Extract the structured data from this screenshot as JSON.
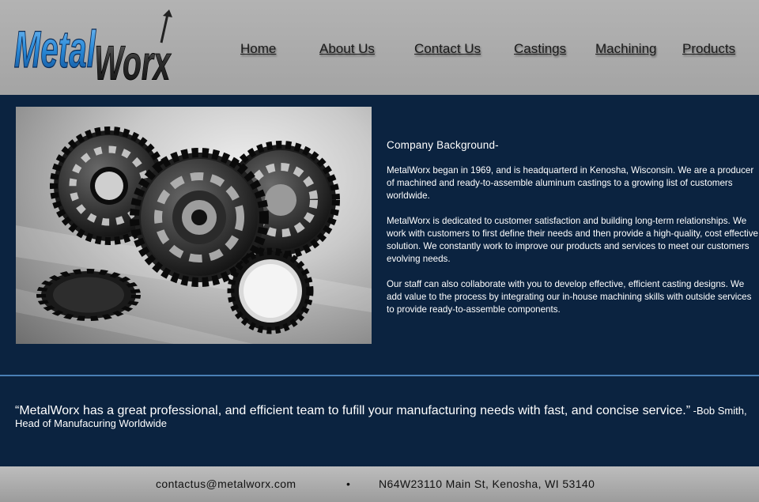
{
  "brand": {
    "logo_text_metal": "Metal",
    "logo_text_worx": "Worx"
  },
  "nav": {
    "items": [
      {
        "label": "Home"
      },
      {
        "label": "About Us"
      },
      {
        "label": "Contact Us"
      },
      {
        "label": "Castings"
      },
      {
        "label": "Machining"
      },
      {
        "label": "Products"
      }
    ]
  },
  "hero_image": {
    "icon": "gears-photo"
  },
  "about": {
    "heading": "Company Background-",
    "paragraphs": [
      "MetalWorx began in 1969, and is headquarterd in Kenosha, Wisconsin. We are a producer of machined and ready-to-assemble aluminum castings to a growing list of customers worldwide.",
      "MetalWorx is dedicated to customer satisfaction and building long-term relationships. We work with customers to first define their needs and then provide a high-quality, cost effective solution. We constantly work to improve our products and services to meet our customers evolving needs.",
      "Our staff can also collaborate with you to develop effective, efficient casting designs. We add value to the process by integrating our in-house machining skills with outside services to provide ready-to-assemble components."
    ]
  },
  "testimonial": {
    "quote": "“MetalWorx has a great professional, and efficient team to fufill your manufacturing needs with fast, and concise service.”",
    "attribution": " -Bob Smith, Head of Manufacuring Worldwide"
  },
  "footer": {
    "email": "contactus@metalworx.com",
    "separator": "•",
    "address": "N64W23110 Main St, Kenosha, WI 53140"
  },
  "colors": {
    "header_bg": "#a9a9a9",
    "body_bg": "#0b2340",
    "divider": "#4a7fb5",
    "logo_blue": "#2a8ad8",
    "logo_dark": "#2c2c2c",
    "text_light": "#ffffff"
  }
}
